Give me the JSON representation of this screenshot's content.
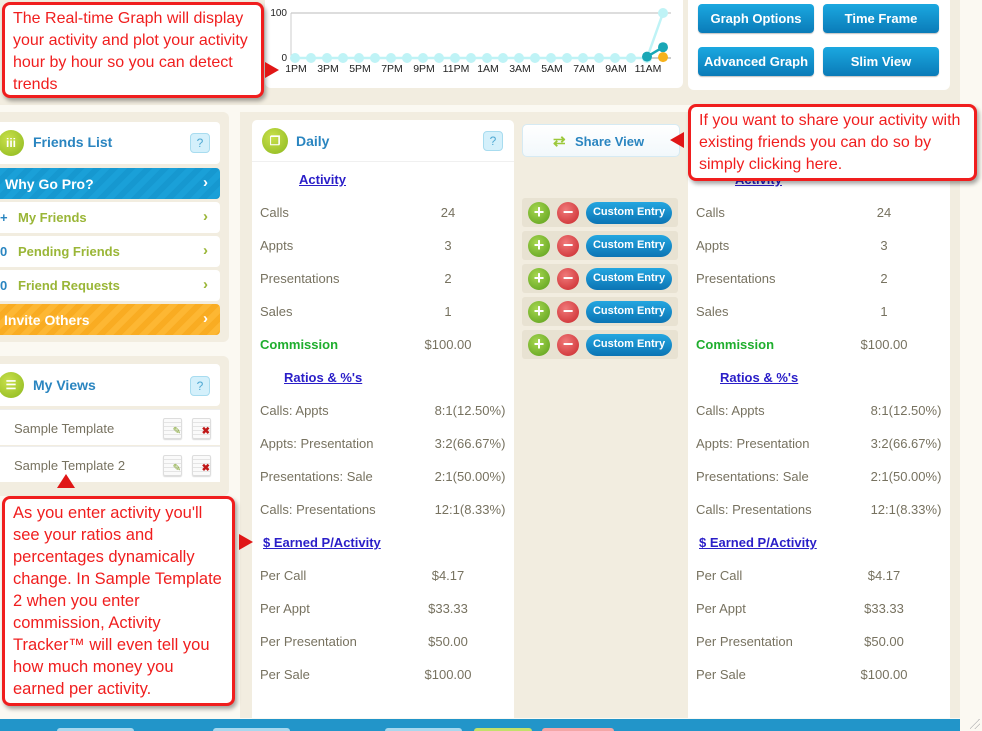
{
  "graph": {
    "y_ticks": [
      "100",
      "0"
    ],
    "x_ticks": [
      "1PM",
      "3PM",
      "5PM",
      "7PM",
      "9PM",
      "11PM",
      "1AM",
      "3AM",
      "5AM",
      "7AM",
      "9AM",
      "11AM"
    ],
    "ylim": [
      0,
      100
    ],
    "series": [
      {
        "name": "light",
        "color": "#bff3f6",
        "values": [
          0,
          0,
          0,
          0,
          0,
          0,
          0,
          0,
          0,
          0,
          0,
          0,
          0,
          0,
          0,
          0,
          0,
          0,
          0,
          0,
          0,
          0,
          0,
          100
        ]
      },
      {
        "name": "dark",
        "color": "#19a7b6",
        "values": [
          null,
          null,
          null,
          null,
          null,
          null,
          null,
          null,
          null,
          null,
          null,
          null,
          null,
          null,
          null,
          null,
          null,
          null,
          null,
          null,
          null,
          null,
          3,
          24
        ]
      },
      {
        "name": "orange",
        "color": "#f6b21c",
        "values": [
          null,
          null,
          null,
          null,
          null,
          null,
          null,
          null,
          null,
          null,
          null,
          null,
          null,
          null,
          null,
          null,
          null,
          null,
          null,
          null,
          null,
          null,
          null,
          2
        ]
      }
    ]
  },
  "graph_buttons": {
    "graph_options": "Graph Options",
    "time_frame": "Time Frame",
    "advanced_graph": "Advanced Graph",
    "slim_view": "Slim View"
  },
  "friends": {
    "title": "Friends List",
    "help": "?",
    "why_pro": "Why Go Pro?",
    "items": [
      {
        "count": "+",
        "label": "My Friends"
      },
      {
        "count": "0",
        "label": "Pending Friends"
      },
      {
        "count": "0",
        "label": "Friend Requests"
      }
    ],
    "invite": "Invite Others",
    "chevron": "›"
  },
  "views": {
    "title": "My Views",
    "help": "?",
    "items": [
      {
        "label": "Sample Template"
      },
      {
        "label": "Sample Template 2"
      }
    ]
  },
  "daily": {
    "title": "Daily",
    "help": "?",
    "activity_heading": "Activity",
    "activity": [
      {
        "label": "Calls",
        "value": "24"
      },
      {
        "label": "Appts",
        "value": "3"
      },
      {
        "label": "Presentations",
        "value": "2"
      },
      {
        "label": "Sales",
        "value": "1"
      }
    ],
    "commission": {
      "label": "Commission",
      "value": "$100.00"
    },
    "ratios_heading": "Ratios & %'s",
    "ratios": [
      {
        "label": "Calls: Appts",
        "value": "8:1(12.50%)"
      },
      {
        "label": "Appts: Presentation",
        "value": "3:2(66.67%)"
      },
      {
        "label": "Presentations: Sale",
        "value": "2:1(50.00%)"
      },
      {
        "label": "Calls: Presentations",
        "value": "12:1(8.33%)"
      }
    ],
    "earned_heading": "$ Earned P/Activity",
    "earned": [
      {
        "label": "Per Call",
        "value": "$4.17"
      },
      {
        "label": "Per Appt",
        "value": "$33.33"
      },
      {
        "label": "Per Presentation",
        "value": "$50.00"
      },
      {
        "label": "Per Sale",
        "value": "$100.00"
      }
    ]
  },
  "share": {
    "label": "Share View",
    "icon": "⇄"
  },
  "entries": {
    "plus": "+",
    "minus": "−",
    "custom": "Custom Entry"
  },
  "callouts": {
    "graph": "The Real-time Graph will display your activity and plot your activity hour by hour so you can detect trends",
    "share": "If you want to share your activity with existing friends you can do so by simply clicking here.",
    "ratios": "As you enter activity you'll see your ratios and percentages dynamically change. In Sample Template 2 when you enter commission, Activity Tracker™ will even tell you how much money you earned per activity."
  },
  "colors": {
    "accent_blue": "#1aa0d8",
    "green": "#9ab637",
    "orange": "#f9ac22",
    "callout_red": "#f01e1e",
    "link": "#2a1ec8"
  }
}
